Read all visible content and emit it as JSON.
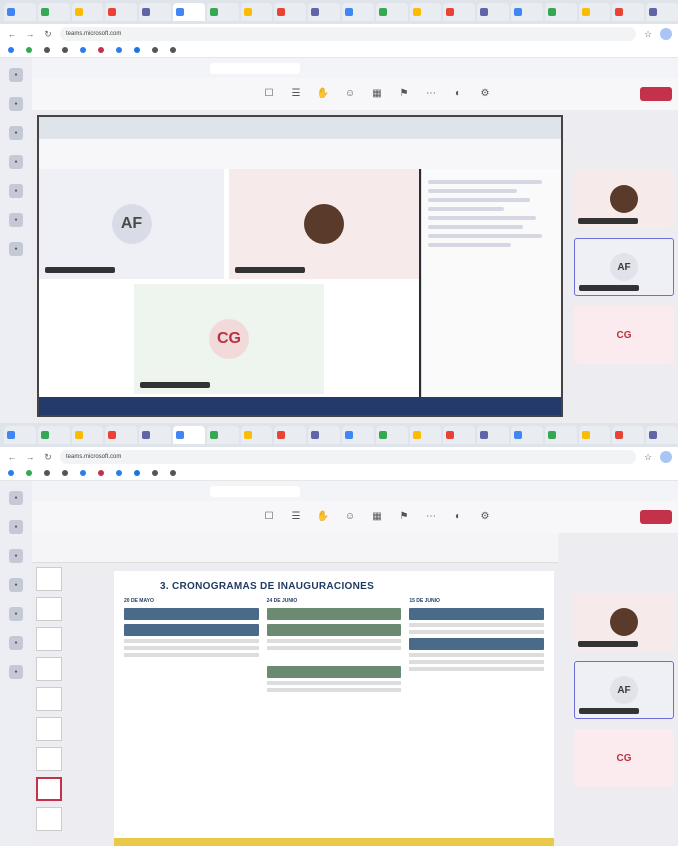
{
  "tabs": [
    "",
    "",
    "",
    "",
    "",
    "",
    "",
    "",
    "",
    "",
    "",
    "",
    "",
    "",
    "",
    "",
    "",
    "",
    "",
    ""
  ],
  "address_bar": {
    "url": "teams.microsoft.com",
    "update_label": ""
  },
  "bookmarks": [
    {
      "label": "",
      "color": "#2b7de9"
    },
    {
      "label": "",
      "color": "#34a853"
    },
    {
      "label": "",
      "color": "#555555"
    },
    {
      "label": "",
      "color": "#555555"
    },
    {
      "label": "",
      "color": "#2b7de9"
    },
    {
      "label": "",
      "color": "#c4314b"
    },
    {
      "label": "",
      "color": "#2b7de9"
    },
    {
      "label": "",
      "color": "#1a73e8"
    },
    {
      "label": "",
      "color": "#555555"
    },
    {
      "label": "",
      "color": "#555555"
    }
  ],
  "teams": {
    "search_placeholder": "",
    "leave_label": ""
  },
  "toolbar": [
    "",
    "",
    "",
    "",
    "",
    "",
    "",
    "",
    ""
  ],
  "meeting": {
    "participants": [
      {
        "initials": "AF",
        "bg": "#eef0f6",
        "avatar": "#d9dce6",
        "color": "#4a4a4a"
      },
      {
        "initials": "",
        "bg": "#f6eaea",
        "avatar": "#5a3a2a",
        "color": "#ffffff"
      },
      {
        "initials": "CG",
        "bg": "#eef4ee",
        "avatar": "#f3dada",
        "color": "#b8323f"
      }
    ],
    "chat_title": "",
    "sidebar": [
      {
        "initials": "",
        "bg": "#f6eaea",
        "avatar": "#5a3a2a",
        "color": "#ffffff"
      },
      {
        "initials": "AF",
        "bg": "#eef0f6",
        "avatar": "#e1e3ea",
        "color": "#3a3a3a"
      },
      {
        "initials": "CG",
        "bg": "#fbeaee",
        "avatar": "#fbeaee",
        "color": "#b8323f"
      }
    ]
  },
  "slide": {
    "title": "3. CRONOGRAMAS DE INAUGURACIONES",
    "days": [
      "20 DE MAYO",
      "24 DE JUNIO",
      "15 DE JUNIO"
    ]
  }
}
